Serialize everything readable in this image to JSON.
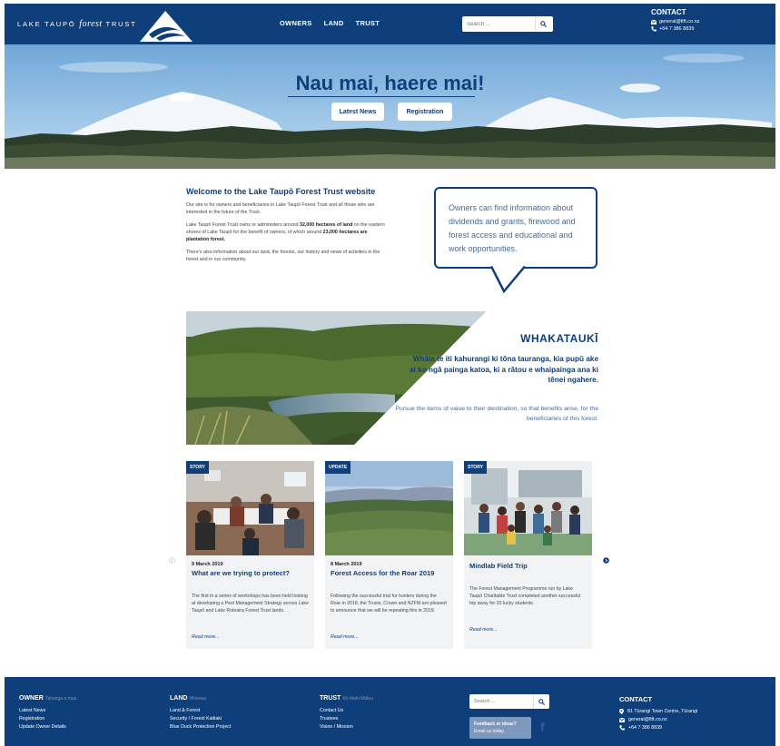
{
  "header": {
    "logo_text_1": "LAKE TAUPŌ",
    "logo_text_forest": "forest",
    "logo_text_2": "TRUST",
    "nav": [
      "OWNERS",
      "LAND",
      "TRUST"
    ],
    "search_placeholder": "Search ...",
    "contact_title": "CONTACT",
    "email": "general@ltft.co.nz",
    "phone": "+64 7 386 8839"
  },
  "hero": {
    "title": "Nau mai, haere mai!",
    "btn_news": "Latest News",
    "btn_registration": "Registration"
  },
  "welcome": {
    "heading": "Welcome to the Lake Taupō Forest Trust website",
    "p1": "Our site is for owners and beneficiaries in Lake Taupō Forest Trust and all those who are interested in the future of the Trust.",
    "p2_a": "Lake Taupō Forest Trust owns or administers around ",
    "p2_b": "32,000 hectares of land",
    "p2_c": " on the eastern shores of Lake Taupō for the benefit of owners, of which around ",
    "p2_d": "23,000 hectares are plantation forest.",
    "p3": "There's also information about our land, the forests, our history and news of activities in the forest and in our community."
  },
  "bubble": {
    "text": "Owners can find information about dividends and grants, firewood and forest access and educational and work opportunities."
  },
  "whakatauki": {
    "title": "WHAKATAUKĪ",
    "maori": "Whāia te iti kahurangi ki tōna tauranga, kia pupū ake ai ko ngā painga katoa, ki a rātou e whaipainga ana ki tēnei ngahere.",
    "english": "Pursue the items of value to their destination, so that benefits arise, for the beneficiaries of this forest."
  },
  "cards": [
    {
      "tag": "STORY",
      "date": "9 March 2019",
      "title": "What are we trying to protect?",
      "body": "The first in a series of workshops has been held looking at developing a Pest Management Strategy across Lake Taupō and Lake Rotoaira Forest Trust lands.",
      "more": "Read more..."
    },
    {
      "tag": "UPDATE",
      "date": "8 March 2019",
      "title": "Forest Access for the Roar 2019",
      "body": "Following the successful trial for hunters during the Roar in 2018, the Trusts, Crown and NZFM are pleased to announce that we will be repeating this in 2019.",
      "more": "Read more..."
    },
    {
      "tag": "STORY",
      "date": "",
      "title": "Mindlab Field Trip",
      "body": "The Forest Management Programme run by Lake Taupō Charitable Trust completed another successful trip away for 20 lucky students.",
      "more": "Read more..."
    }
  ],
  "footer": {
    "owner": {
      "heading": "OWNER",
      "sub": "Tahunga a mua",
      "links": [
        "Latest News",
        "Registration",
        "Update Owner Details"
      ]
    },
    "land": {
      "heading": "LAND",
      "sub": "Whenua",
      "links": [
        "Land & Forest",
        "Security / Forest Kaitiaki",
        "Blue Duck Protection Project"
      ]
    },
    "trust": {
      "heading": "TRUST",
      "sub": "Kō ētahi Mātou",
      "links": [
        "Contact Us",
        "Trustees",
        "Vision / Mission"
      ]
    },
    "search_placeholder": "Search ...",
    "feedback_1": "Feedback or ideas?",
    "feedback_2": "Email us today.",
    "facebook": "f",
    "contact_title": "CONTACT",
    "address": "81 Tūrangi Town Centre, Tūrangi",
    "email": "general@ltft.co.nz",
    "phone": "+64 7 386 8839"
  },
  "colors": {
    "brand": "#0e3f7a",
    "accent_light": "#7d97bd"
  }
}
